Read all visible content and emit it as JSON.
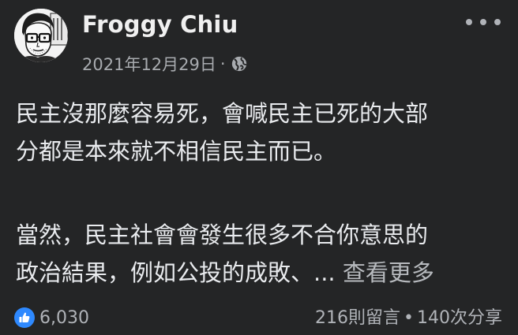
{
  "post": {
    "author": "Froggy Chiu",
    "date": "2021年12月29日",
    "separator": "·",
    "privacy_icon": "globe-icon",
    "body_p1_line1": "民主沒那麼容易死，會喊民主已死的大部",
    "body_p1_line2": "分都是本來就不相信民主而已。",
    "body_p2_line1": "當然，民主社會會發生很多不合你意思的",
    "body_p2_line2": "政治結果，例如公投的成敗、...",
    "see_more": "查看更多"
  },
  "footer": {
    "reaction_icon": "thumbs-up-icon",
    "like_count": "6,030",
    "comments": "216則留言",
    "dot": "•",
    "shares": "140次分享"
  },
  "colors": {
    "background": "#242526",
    "text": "#e4e6eb",
    "secondary": "#b0b3b8",
    "like_blue": "#2e89ff"
  }
}
